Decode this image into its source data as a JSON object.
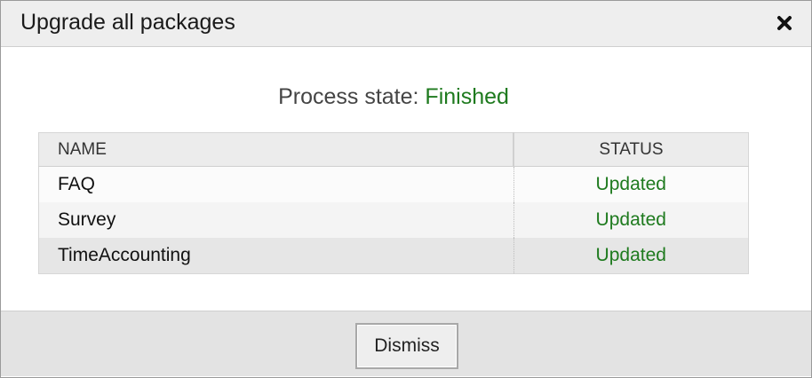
{
  "dialog": {
    "title": "Upgrade all packages",
    "close_icon": "close-icon"
  },
  "process": {
    "label": "Process state:",
    "value": "Finished",
    "value_color": "#1e7a1e"
  },
  "table": {
    "columns": [
      "NAME",
      "STATUS"
    ],
    "rows": [
      {
        "name": "FAQ",
        "status": "Updated"
      },
      {
        "name": "Survey",
        "status": "Updated"
      },
      {
        "name": "TimeAccounting",
        "status": "Updated"
      }
    ]
  },
  "footer": {
    "dismiss_label": "Dismiss"
  }
}
